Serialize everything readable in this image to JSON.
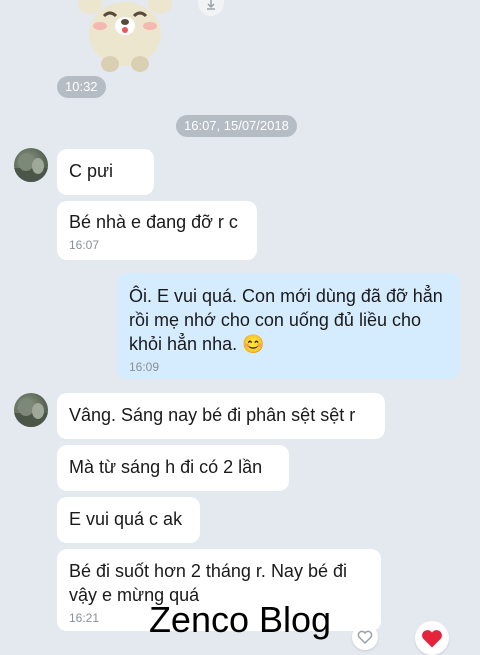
{
  "top": {
    "sticker_icon": "bear-sticker-icon",
    "download_icon": "download-icon",
    "sticker_time": "10:32"
  },
  "date_separator": "16:07, 15/07/2018",
  "messages": [
    {
      "side": "left",
      "text": "C pưi",
      "time": ""
    },
    {
      "side": "left",
      "text": "Bé nhà e đang đỡ r c",
      "time": "16:07"
    },
    {
      "side": "right",
      "text": "Ôi. E vui quá. Con mới dùng đã đỡ hẳn rồi mẹ nhớ cho con uống đủ liều cho khỏi hẳn nha. ",
      "emoji": "😊",
      "time": "16:09"
    },
    {
      "side": "left",
      "text": "Vâng. Sáng nay bé đi phân sệt sệt r",
      "time": ""
    },
    {
      "side": "left",
      "text": "Mà từ sáng h đi có 2 lần",
      "time": ""
    },
    {
      "side": "left",
      "text": "E vui quá c ak",
      "time": ""
    },
    {
      "side": "left",
      "text": "Bé đi suốt hơn 2 tháng r. Nay bé đi vậy e mừng quá",
      "time": "16:21"
    }
  ],
  "reactions": {
    "like_icon": "heart-outline-icon",
    "sent_icon": "heart-filled-icon"
  },
  "watermark": "Zenco Blog",
  "colors": {
    "background": "#e4e9ef",
    "bubble_incoming": "#ffffff",
    "bubble_outgoing": "#d5ecff",
    "heart": "#e5243b"
  }
}
